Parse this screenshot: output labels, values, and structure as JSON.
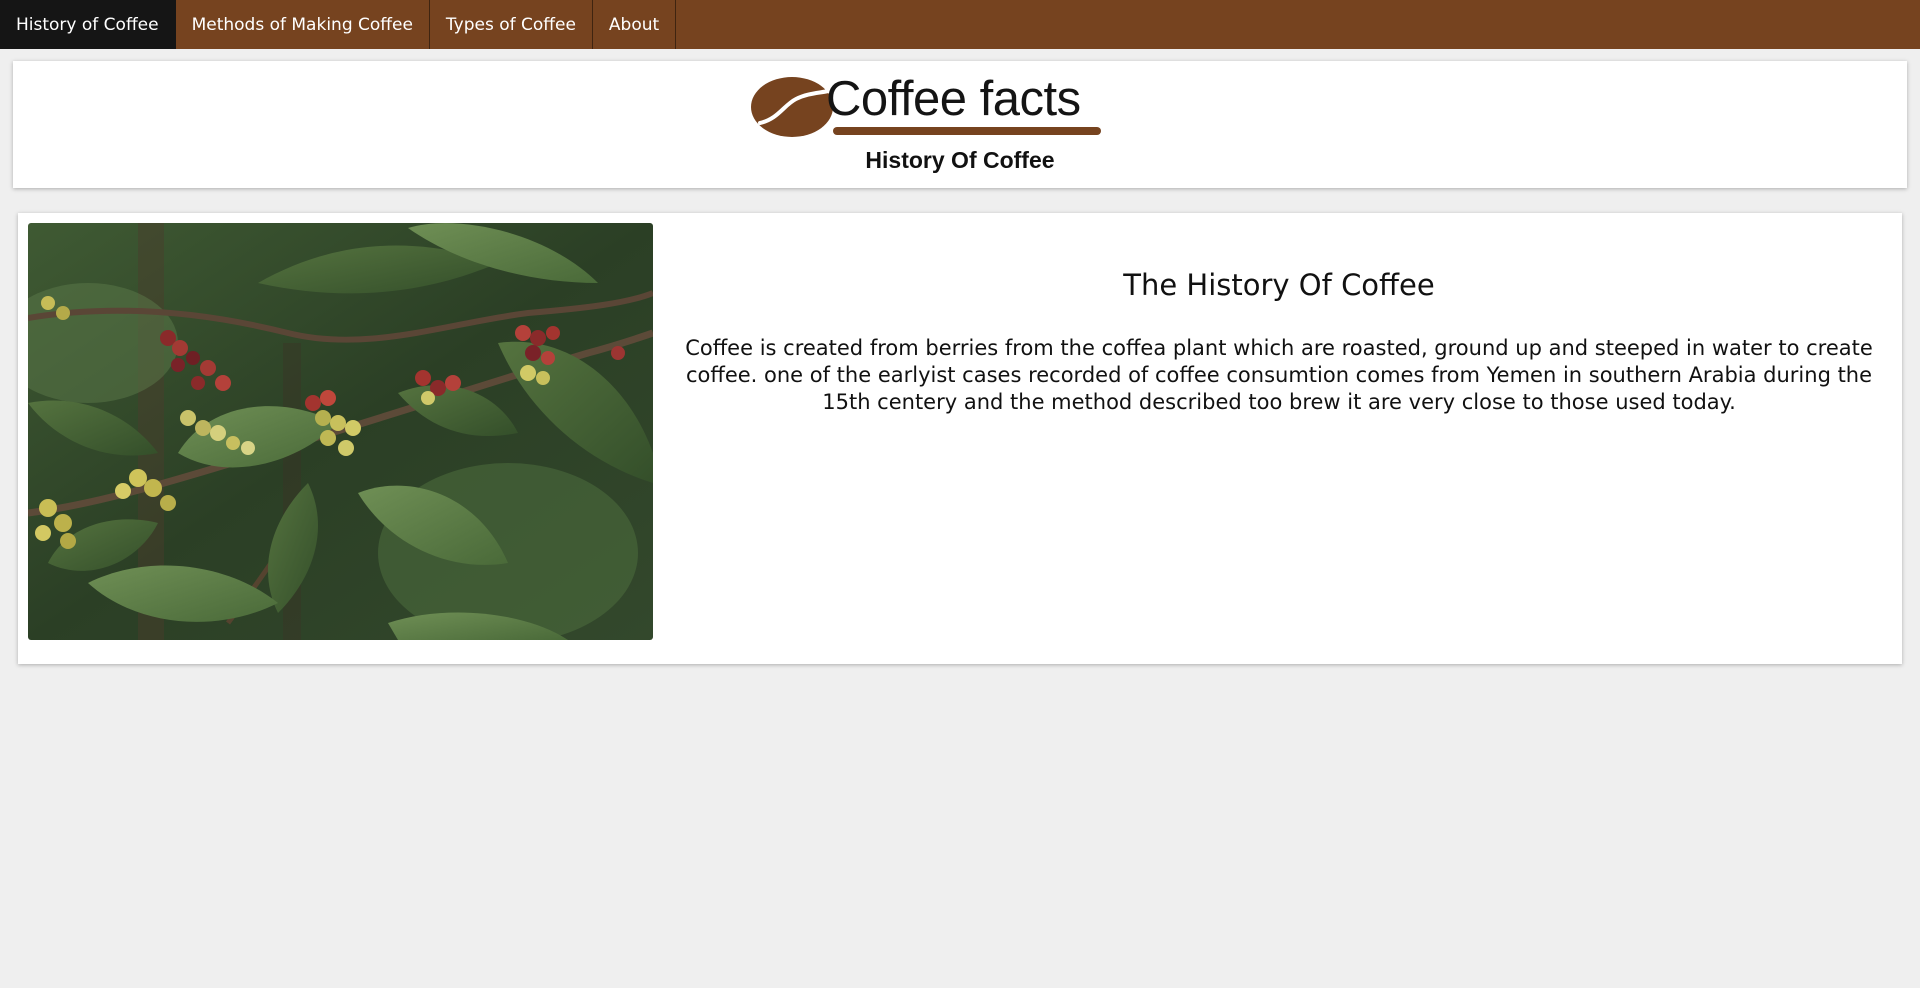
{
  "nav": {
    "items": [
      {
        "label": "History of Coffee",
        "active": true
      },
      {
        "label": "Methods of Making Coffee",
        "active": false
      },
      {
        "label": "Types of Coffee",
        "active": false
      },
      {
        "label": "About",
        "active": false
      }
    ]
  },
  "header": {
    "logo_text": "Coffee facts",
    "subtitle": "History Of Coffee"
  },
  "main": {
    "image_icon": "coffee-plant-photo",
    "title": "The History Of Coffee",
    "text": "Coffee is created from berries from the coffea plant which are roasted, ground up and steeped in water to create coffee. one of the earlyist cases recorded of coffee consumtion comes from Yemen in southern Arabia during the 15th centery and the method described too brew it are very close to those used today."
  },
  "colors": {
    "brand_brown": "#76431f",
    "nav_active": "#151515",
    "page_background": "#efefef"
  }
}
